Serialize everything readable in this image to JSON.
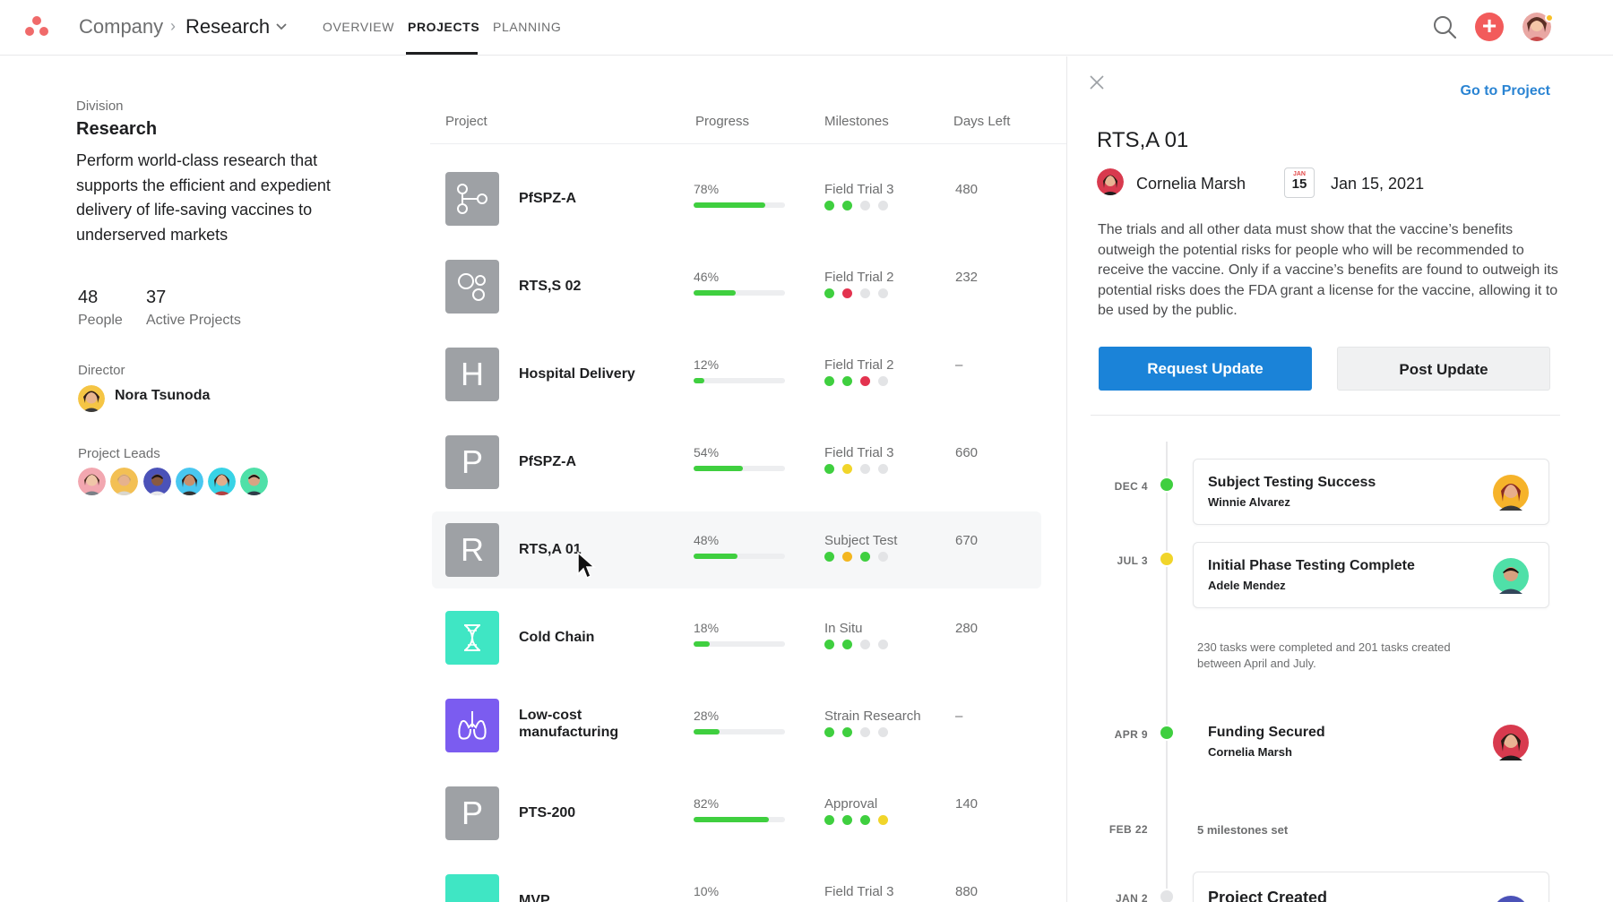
{
  "header": {
    "breadcrumb_parent": "Company",
    "breadcrumb_current": "Research",
    "tabs": [
      "OVERVIEW",
      "PROJECTS",
      "PLANNING"
    ],
    "active_tab": "PROJECTS"
  },
  "division": {
    "label": "Division",
    "name": "Research",
    "description": "Perform world-class research that supports the efficient and expedient delivery of life-saving vaccines to underserved markets",
    "people_count": "48",
    "people_label": "People",
    "projects_count": "37",
    "projects_label": "Active Projects",
    "director_label": "Director",
    "director_name": "Nora Tsunoda",
    "leads_label": "Project Leads"
  },
  "table": {
    "headers": {
      "project": "Project",
      "progress": "Progress",
      "milestones": "Milestones",
      "days_left": "Days Left"
    },
    "rows": [
      {
        "name": "PfSPZ-A",
        "tile": "network-icon",
        "progress": "78%",
        "progress_value": 0.78,
        "milestone": "Field Trial 3",
        "dots": [
          "green",
          "green",
          "gray",
          "gray"
        ],
        "days": "480"
      },
      {
        "name": "RTS,S 02",
        "tile": "molecule-icon",
        "progress": "46%",
        "progress_value": 0.46,
        "milestone": "Field Trial 2",
        "dots": [
          "green",
          "red",
          "gray",
          "gray"
        ],
        "days": "232"
      },
      {
        "name": "Hospital Delivery",
        "tile": "H",
        "progress": "12%",
        "progress_value": 0.12,
        "milestone": "Field Trial 2",
        "dots": [
          "green",
          "green",
          "red",
          "gray"
        ],
        "days": "–"
      },
      {
        "name": "PfSPZ-A",
        "tile": "P",
        "progress": "54%",
        "progress_value": 0.54,
        "milestone": "Field Trial 3",
        "dots": [
          "green",
          "yellow",
          "gray",
          "gray"
        ],
        "days": "660"
      },
      {
        "name": "RTS,A 01",
        "tile": "R",
        "progress": "48%",
        "progress_value": 0.48,
        "milestone": "Subject Test",
        "dots": [
          "green",
          "orange",
          "green",
          "gray"
        ],
        "days": "670"
      },
      {
        "name": "Cold Chain",
        "tile": "dna-icon",
        "progress": "18%",
        "progress_value": 0.18,
        "milestone": "In Situ",
        "dots": [
          "green",
          "green",
          "gray",
          "gray"
        ],
        "days": "280"
      },
      {
        "name": "Low-cost manufacturing",
        "tile": "lungs-icon",
        "progress": "28%",
        "progress_value": 0.28,
        "milestone": "Strain Research",
        "dots": [
          "green",
          "green",
          "gray",
          "gray"
        ],
        "days": "–"
      },
      {
        "name": "PTS-200",
        "tile": "P",
        "progress": "82%",
        "progress_value": 0.82,
        "milestone": "Approval",
        "dots": [
          "green",
          "green",
          "green",
          "yellow"
        ],
        "days": "140"
      },
      {
        "name": "MVP",
        "tile": "",
        "progress": "10%",
        "progress_value": 0.1,
        "milestone": "Field Trial 3",
        "dots": [],
        "days": "880"
      }
    ]
  },
  "detail": {
    "goto_label": "Go to Project",
    "title": "RTS,A 01",
    "owner": "Cornelia Marsh",
    "cal_month": "JAN",
    "cal_day": "15",
    "date": "Jan 15, 2021",
    "description": "The trials and all other data must show that the vaccine’s benefits outweigh the potential risks for people who will be recommended to receive the vaccine. Only if a vaccine’s benefits are found to outweigh its potential risks does the FDA grant a license for the vaccine, allowing it to be used by the public.",
    "request_label": "Request Update",
    "post_label": "Post Update",
    "timeline": [
      {
        "date": "DEC 4",
        "status": "green",
        "title": "Subject Testing Success",
        "person": "Winnie Alvarez"
      },
      {
        "date": "JUL 3",
        "status": "yellow",
        "title": "Initial Phase Testing Complete",
        "person": "Adele Mendez"
      },
      {
        "note": "230 tasks were completed and 201 tasks created between April and July."
      },
      {
        "date": "APR 9",
        "status": "green",
        "title": "Funding Secured",
        "person": "Cornelia Marsh"
      },
      {
        "date": "FEB 22",
        "note": "5 milestones set"
      },
      {
        "date": "JAN 2",
        "status": "gray",
        "title": "Project Created"
      }
    ]
  },
  "colors": {
    "green": "#3fcf3f",
    "red": "#e3334f",
    "yellow": "#f1d52a",
    "orange": "#f3b61f",
    "gray": "#e3e4e6",
    "primary": "#1b83d8",
    "brand": "#f06a6a",
    "teal": "#3fe6c4",
    "purple": "#7b5cf0"
  }
}
